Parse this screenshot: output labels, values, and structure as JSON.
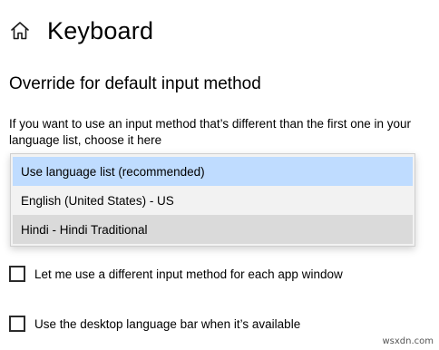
{
  "page": {
    "title": "Keyboard",
    "home_icon": "home-icon"
  },
  "section": {
    "heading": "Override for default input method",
    "description": "If you want to use an input method that’s different than the first one in your language list, choose it here"
  },
  "dropdown": {
    "options": [
      {
        "label": "Use language list (recommended)",
        "state": "selected"
      },
      {
        "label": "English (United States) - US",
        "state": "normal"
      },
      {
        "label": "Hindi - Hindi Traditional",
        "state": "hover"
      }
    ],
    "selected_color": "#bfdcff",
    "hover_color": "#dadada"
  },
  "checkboxes": [
    {
      "label": "Let me use a different input method for each app window",
      "checked": false
    },
    {
      "label": "Use the desktop language bar when it’s available",
      "checked": false
    }
  ],
  "watermark": "wsxdn.com"
}
